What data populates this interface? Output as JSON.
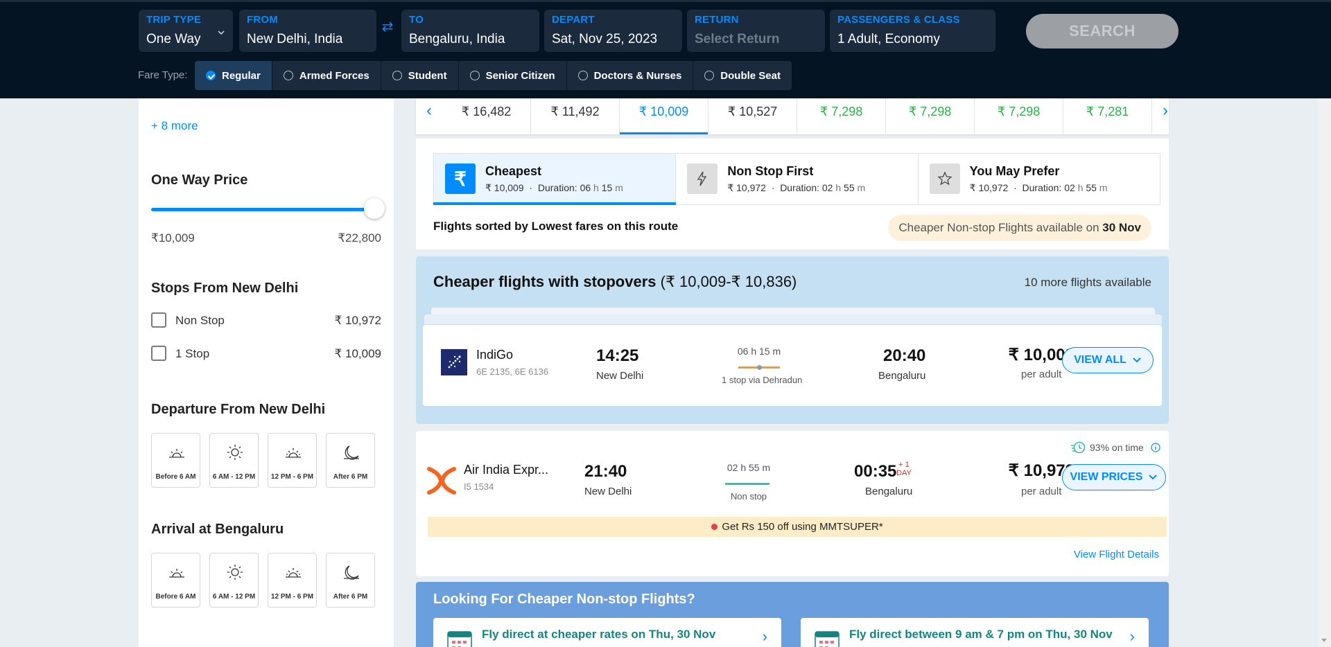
{
  "search": {
    "trip_type": {
      "label": "TRIP TYPE",
      "value": "One Way"
    },
    "from": {
      "label": "FROM",
      "value": "New Delhi, India"
    },
    "to": {
      "label": "TO",
      "value": "Bengaluru, India"
    },
    "depart": {
      "label": "DEPART",
      "value": "Sat, Nov 25, 2023"
    },
    "return": {
      "label": "RETURN",
      "placeholder": "Select Return"
    },
    "passengers": {
      "label": "PASSENGERS & CLASS",
      "value": "1 Adult, Economy"
    },
    "search_label": "SEARCH",
    "fare_type_label": "Fare Type:",
    "fare_types": [
      {
        "label": "Regular",
        "selected": true
      },
      {
        "label": "Armed Forces",
        "selected": false
      },
      {
        "label": "Student",
        "selected": false
      },
      {
        "label": "Senior Citizen",
        "selected": false
      },
      {
        "label": "Doctors & Nurses",
        "selected": false
      },
      {
        "label": "Double Seat",
        "selected": false
      }
    ]
  },
  "sidebar": {
    "more_link": "+ 8 more",
    "price_heading": "One Way Price",
    "price_min": "₹10,009",
    "price_max": "₹22,800",
    "price_slider_fraction": 1.0,
    "stops_heading": "Stops From New Delhi",
    "stops": [
      {
        "label": "Non Stop",
        "price": "₹ 10,972"
      },
      {
        "label": "1 Stop",
        "price": "₹ 10,009"
      }
    ],
    "departure_heading": "Departure From New Delhi",
    "arrival_heading": "Arrival at Bengaluru",
    "time_slots": [
      {
        "label": "Before 6 AM",
        "icon": "sunrise-icon"
      },
      {
        "label": "6 AM - 12 PM",
        "icon": "sun-icon"
      },
      {
        "label": "12 PM - 6 PM",
        "icon": "sunset-icon"
      },
      {
        "label": "After 6 PM",
        "icon": "moon-icon"
      }
    ]
  },
  "date_strip": {
    "prices": [
      {
        "price": "₹ 16,482",
        "style": "normal"
      },
      {
        "price": "₹ 11,492",
        "style": "normal"
      },
      {
        "price": "₹ 10,009",
        "style": "selected"
      },
      {
        "price": "₹ 10,527",
        "style": "normal"
      },
      {
        "price": "₹ 7,298",
        "style": "green"
      },
      {
        "price": "₹ 7,298",
        "style": "green"
      },
      {
        "price": "₹ 7,298",
        "style": "green"
      },
      {
        "price": "₹ 7,281",
        "style": "green"
      }
    ]
  },
  "sort": {
    "tabs": [
      {
        "title": "Cheapest",
        "price": "₹ 10,009",
        "duration_label": "Duration:",
        "hours": "06",
        "minutes": "15",
        "icon": "rupee-icon",
        "selected": true
      },
      {
        "title": "Non Stop First",
        "price": "₹ 10,972",
        "duration_label": "Duration:",
        "hours": "02",
        "minutes": "55",
        "icon": "lightning-icon",
        "selected": false
      },
      {
        "title": "You May Prefer",
        "price": "₹ 10,972",
        "duration_label": "Duration:",
        "hours": "02",
        "minutes": "55",
        "icon": "star-icon",
        "selected": false
      }
    ],
    "sorted_note": "Flights sorted by Lowest fares on this route",
    "cheaper_pill_prefix": "Cheaper Non-stop Flights available on ",
    "cheaper_pill_date": "30 Nov"
  },
  "stopover": {
    "title_bold": "Cheaper flights with stopovers",
    "title_range": " (₹ 10,009-₹ 10,836)",
    "more_available": "10 more flights available",
    "flight": {
      "airline": "IndiGo",
      "flight_numbers": "6E 2135, 6E 6136",
      "dep_time": "14:25",
      "dep_city": "New Delhi",
      "duration": "06 h 15 m",
      "via": "1 stop via Dehradun",
      "arr_time": "20:40",
      "arr_city": "Bengaluru",
      "price": "₹ 10,009",
      "per": "per adult",
      "button": "VIEW ALL"
    }
  },
  "flight2": {
    "airline": "Air India Expr...",
    "flight_number": "I5 1534",
    "dep_time": "21:40",
    "dep_city": "New Delhi",
    "duration": "02 h 55 m",
    "stop_label": "Non stop",
    "arr_time": "00:35",
    "plus_day_1": "+ 1",
    "plus_day_2": "DAY",
    "arr_city": "Bengaluru",
    "price": "₹ 10,972",
    "per": "per adult",
    "button": "VIEW PRICES",
    "on_time": "93% on time",
    "promo": "Get Rs 150 off using MMTSUPER*",
    "details_link": "View Flight Details"
  },
  "nonstop": {
    "title": "Looking For Cheaper Non-stop Flights?",
    "cards": [
      {
        "text": "Fly direct at cheaper rates on Thu, 30 Nov"
      },
      {
        "text": "Fly direct between 9 am & 7 pm on Thu, 30 Nov"
      }
    ]
  },
  "colors": {
    "accent": "#008cff",
    "header_bg": "#051423",
    "green_price": "#2db24a",
    "stopover_bg": "#c5e0f3",
    "nonstop_bg": "#6b9edc"
  }
}
